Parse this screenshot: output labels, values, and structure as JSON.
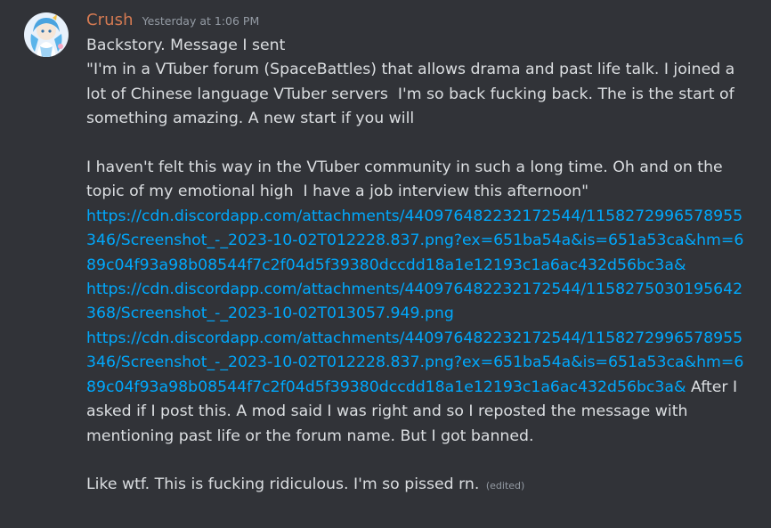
{
  "message": {
    "author": "Crush",
    "timestamp": "Yesterday at 1:06 PM",
    "text_1": "Backstory. Message I sent\n\"I'm in a VTuber forum (SpaceBattles) that allows drama and past life talk. I joined a lot of Chinese language VTuber servers  I'm so back fucking back. The is the start of something amazing. A new start if you will\n\nI haven't felt this way in the VTuber community in such a long time. Oh and on the topic of my emotional high  I have a job interview this afternoon\"\n",
    "link_1": "https://cdn.discordapp.com/attachments/440976482232172544/1158272996578955346/Screenshot_-_2023-10-02T012228.837.png?ex=651ba54a&is=651a53ca&hm=689c04f93a98b08544f7c2f04d5f39380dccdd18a1e12193c1a6ac432d56bc3a&",
    "link_2": "https://cdn.discordapp.com/attachments/440976482232172544/1158275030195642368/Screenshot_-_2023-10-02T013057.949.png",
    "link_3": "https://cdn.discordapp.com/attachments/440976482232172544/1158272996578955346/Screenshot_-_2023-10-02T012228.837.png?ex=651ba54a&is=651a53ca&hm=689c04f93a98b08544f7c2f04d5f39380dccdd18a1e12193c1a6ac432d56bc3a&",
    "text_2": " After I asked if I post this. A mod said I was right and so I reposted the message with mentioning past life or the forum name. But I got banned.\n\nLike wtf. This is fucking ridiculous. I'm so pissed rn.",
    "edited_label": "(edited)"
  },
  "colors": {
    "background": "#313338",
    "username": "#d47a52",
    "link": "#00a8fc",
    "text": "#dbdee1",
    "muted": "#949ba4"
  }
}
